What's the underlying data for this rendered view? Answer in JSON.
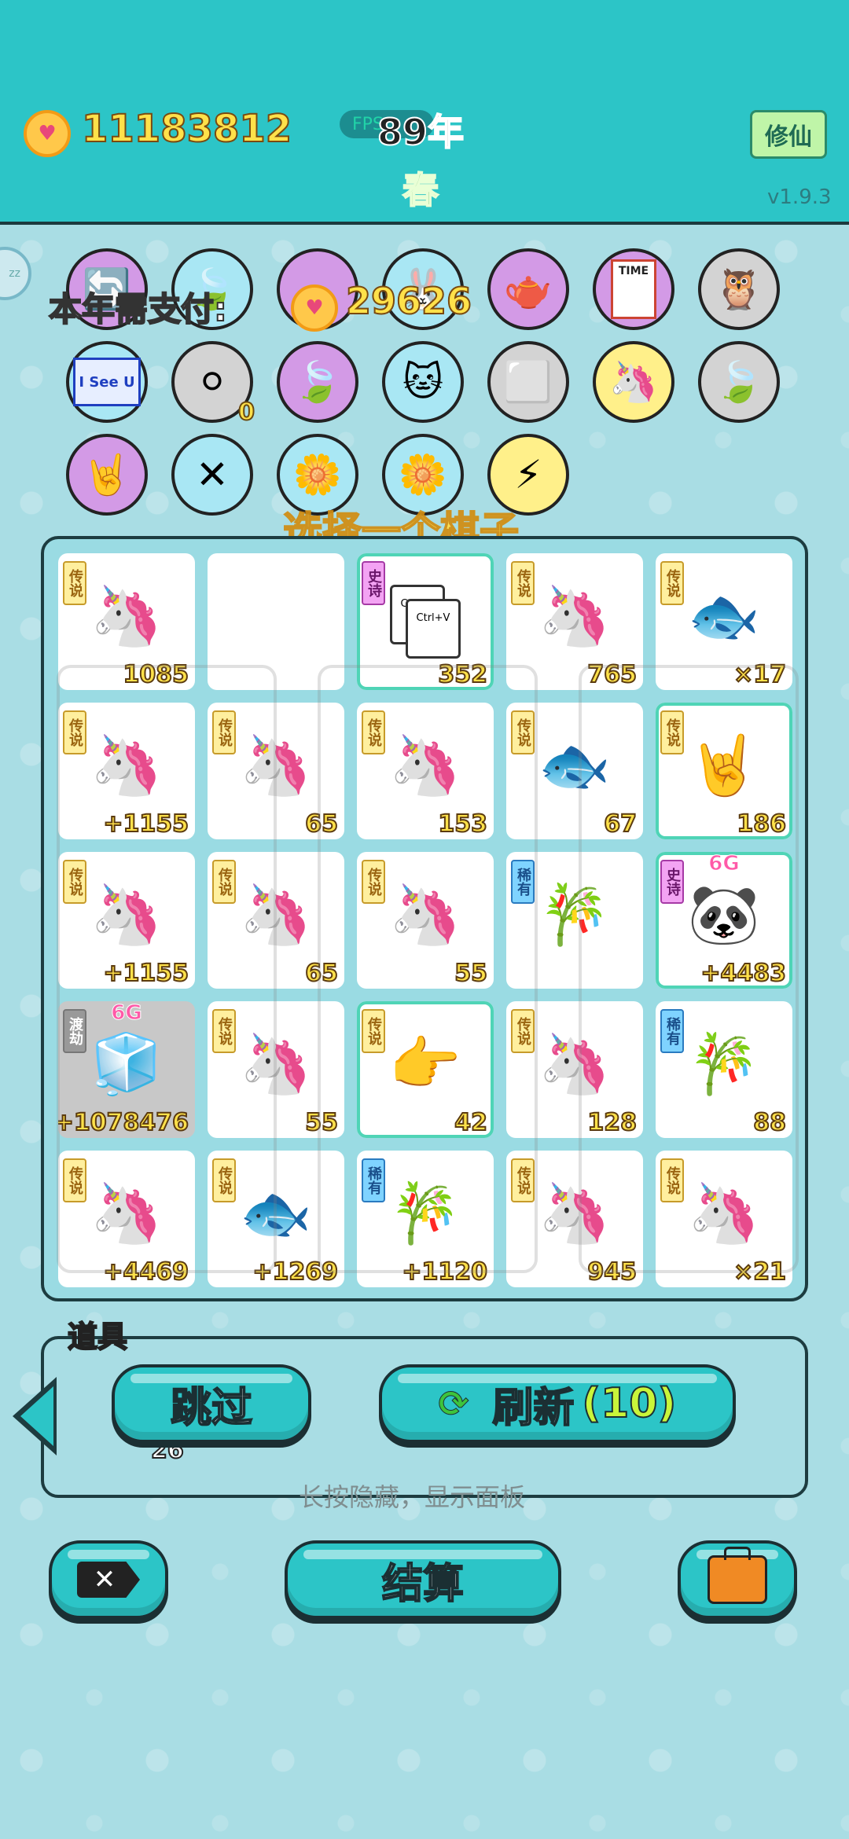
{
  "header": {
    "coins": "11183812",
    "fps_label": "FPS",
    "year": "89年",
    "season": "春",
    "cultivate_button": "修仙",
    "version": "v1.9.3",
    "sleep_label": "zz"
  },
  "payment": {
    "label": "本年需支付:",
    "amount": "29626"
  },
  "relics": {
    "row1": [
      {
        "icon": "refresh-icon",
        "glyph": "🔄",
        "bg": "pink"
      },
      {
        "icon": "leaf-icon",
        "glyph": "🍃",
        "bg": "blue"
      },
      {
        "icon": "cloud-brain-icon",
        "glyph": "☁",
        "bg": "pink"
      },
      {
        "icon": "bunny-icon",
        "glyph": "🐰",
        "bg": "blue"
      },
      {
        "icon": "gravy-boat-icon",
        "glyph": "🫖",
        "bg": "pink"
      },
      {
        "icon": "time-magazine-icon",
        "glyph": "TIME",
        "bg": "pink"
      },
      {
        "icon": "owls-icon",
        "glyph": "🦉",
        "bg": "gray"
      }
    ],
    "row2": [
      {
        "icon": "i-see-u-icon",
        "glyph": "I See U",
        "bg": "blue"
      },
      {
        "icon": "egg-tray-icon",
        "glyph": "⚪",
        "bg": "gray",
        "count": "0"
      },
      {
        "icon": "leaf-icon",
        "glyph": "🍃",
        "bg": "pink"
      },
      {
        "icon": "cat-icon",
        "glyph": "🐱",
        "bg": "blue"
      },
      {
        "icon": "sugar-cubes-icon",
        "glyph": "⬜",
        "bg": "gray"
      },
      {
        "icon": "unicorn-icon",
        "glyph": "🦄",
        "bg": "yellow"
      },
      {
        "icon": "leaf-icon",
        "glyph": "🍃",
        "bg": "gray"
      }
    ],
    "row3": [
      {
        "icon": "rock-hand-icon",
        "glyph": "🤘",
        "bg": "pink"
      },
      {
        "icon": "chopsticks-icon",
        "glyph": "✕",
        "bg": "blue"
      },
      {
        "icon": "flower-pot-icon",
        "glyph": "🌼",
        "bg": "blue"
      },
      {
        "icon": "flower-pot-icon",
        "glyph": "🌼",
        "bg": "blue"
      },
      {
        "icon": "lightning-icon",
        "glyph": "⚡",
        "bg": "yellow"
      }
    ]
  },
  "choose_prompt": "选择一个棋子",
  "board": {
    "cells": [
      {
        "tag": "传说",
        "tag_type": "legend",
        "icon": "crowned-unicorn-icon",
        "glyph": "🦄",
        "value": "1085"
      },
      {
        "tag": "",
        "tag_type": "",
        "icon": "",
        "glyph": "",
        "value": ""
      },
      {
        "tag": "史诗",
        "tag_type": "epic",
        "icon": "copy-paste-icon",
        "glyph": "",
        "value": "352",
        "highlight": true,
        "copy1": "Ctrl+C",
        "copy2": "Ctrl+V"
      },
      {
        "tag": "传说",
        "tag_type": "legend",
        "icon": "crowned-unicorn-icon",
        "glyph": "🦄",
        "value": "765"
      },
      {
        "tag": "传说",
        "tag_type": "legend",
        "icon": "koi-fish-icon",
        "glyph": "🐟",
        "value": "×17"
      },
      {
        "tag": "传说",
        "tag_type": "legend",
        "icon": "unicorn-icon",
        "glyph": "🦄",
        "value": "+1155"
      },
      {
        "tag": "传说",
        "tag_type": "legend",
        "icon": "unicorn-icon",
        "glyph": "🦄",
        "value": "65"
      },
      {
        "tag": "传说",
        "tag_type": "legend",
        "icon": "unicorn-icon",
        "glyph": "🦄",
        "value": "153"
      },
      {
        "tag": "传说",
        "tag_type": "legend",
        "icon": "koi-fish-icon",
        "glyph": "🐟",
        "value": "67"
      },
      {
        "tag": "传说",
        "tag_type": "legend",
        "icon": "rock-hand-icon",
        "glyph": "🤘",
        "value": "186",
        "highlight": true
      },
      {
        "tag": "传说",
        "tag_type": "legend",
        "icon": "crowned-unicorn-icon",
        "glyph": "🦄",
        "value": "+1155"
      },
      {
        "tag": "传说",
        "tag_type": "legend",
        "icon": "crowned-unicorn-icon",
        "glyph": "🦄",
        "value": "65"
      },
      {
        "tag": "传说",
        "tag_type": "legend",
        "icon": "crowned-unicorn-icon",
        "glyph": "🦄",
        "value": "55"
      },
      {
        "tag": "稀有",
        "tag_type": "rare",
        "icon": "bamboo-icon",
        "glyph": "🎋",
        "value": ""
      },
      {
        "tag": "史诗",
        "tag_type": "epic",
        "icon": "panda-icon",
        "glyph": "🐼",
        "value": "+4483",
        "highlight": true,
        "gtag": "6G"
      },
      {
        "tag": "渡劫",
        "tag_type": "dujie",
        "icon": "crowned-fridge-icon",
        "glyph": "🧊",
        "value": "+1078476",
        "gtag": "6G",
        "fridge": true
      },
      {
        "tag": "传说",
        "tag_type": "legend",
        "icon": "unicorn-icon",
        "glyph": "🦄",
        "value": "55"
      },
      {
        "tag": "传说",
        "tag_type": "legend",
        "icon": "pointing-hand-icon",
        "glyph": "👉",
        "value": "42",
        "highlight": true
      },
      {
        "tag": "传说",
        "tag_type": "legend",
        "icon": "unicorn-icon",
        "glyph": "🦄",
        "value": "128"
      },
      {
        "tag": "稀有",
        "tag_type": "rare",
        "icon": "bamboo-icon",
        "glyph": "🎋",
        "value": "88"
      },
      {
        "tag": "传说",
        "tag_type": "legend",
        "icon": "unicorn-icon",
        "glyph": "🦄",
        "value": "+4469"
      },
      {
        "tag": "传说",
        "tag_type": "legend",
        "icon": "koi-fish-icon",
        "glyph": "🐟",
        "value": "+1269"
      },
      {
        "tag": "稀有",
        "tag_type": "rare",
        "icon": "bamboo-icon",
        "glyph": "🎋",
        "value": "+1120"
      },
      {
        "tag": "传说",
        "tag_type": "legend",
        "icon": "unicorn-icon",
        "glyph": "🦄",
        "value": "945"
      },
      {
        "tag": "传说",
        "tag_type": "legend",
        "icon": "crowned-unicorn-icon",
        "glyph": "🦄",
        "value": "×21"
      }
    ]
  },
  "items": {
    "label": "道具",
    "item_count": "26",
    "skip_button": "跳过",
    "refresh_button": "刷新",
    "refresh_count": "(10)",
    "hint": "长按隐藏，显示面板"
  },
  "footer": {
    "settle_button": "结算"
  }
}
